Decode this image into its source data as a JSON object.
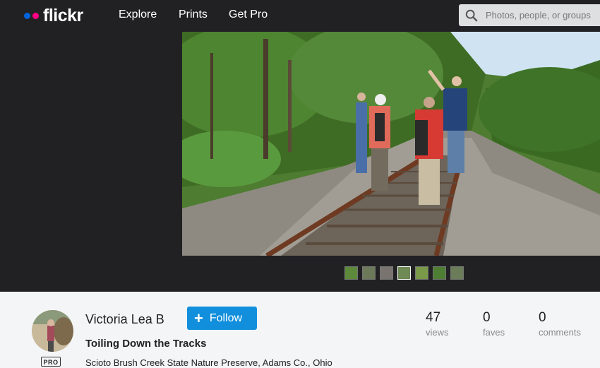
{
  "header": {
    "logo": "flickr",
    "nav": [
      "Explore",
      "Prints",
      "Get Pro"
    ],
    "search_placeholder": "Photos, people, or groups"
  },
  "photo": {
    "alt": "Hikers walking down railroad tracks through a wooded area"
  },
  "owner": {
    "name": "Victoria Lea B",
    "pro_badge": "PRO",
    "follow_label": "Follow"
  },
  "title": "Toiling Down the Tracks",
  "description": "Scioto Brush Creek State Nature Preserve, Adams Co., Ohio",
  "stats": {
    "views": {
      "count": "47",
      "label": "views"
    },
    "faves": {
      "count": "0",
      "label": "faves"
    },
    "comments": {
      "count": "0",
      "label": "comments"
    }
  },
  "colors": {
    "accent": "#128fdc",
    "logo_blue": "#0063dc",
    "logo_pink": "#ff0084",
    "topbar": "#212124"
  }
}
